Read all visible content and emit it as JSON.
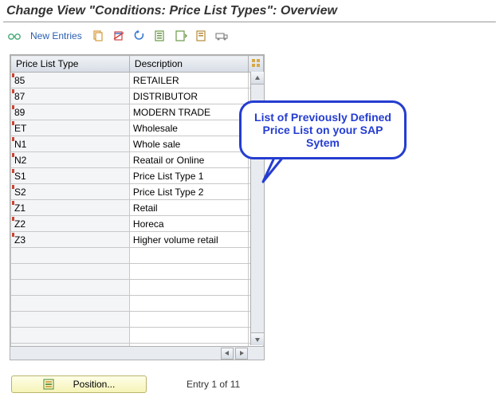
{
  "title": "Change View \"Conditions: Price List Types\": Overview",
  "toolbar": {
    "new_entries": "New Entries"
  },
  "table": {
    "headers": {
      "code": "Price List Type",
      "desc": "Description"
    },
    "rows": [
      {
        "code": "85",
        "desc": "RETAILER"
      },
      {
        "code": "87",
        "desc": "DISTRIBUTOR"
      },
      {
        "code": "89",
        "desc": "MODERN TRADE"
      },
      {
        "code": "ET",
        "desc": "Wholesale"
      },
      {
        "code": "N1",
        "desc": "Whole sale"
      },
      {
        "code": "N2",
        "desc": "Reatail or Online"
      },
      {
        "code": "S1",
        "desc": "Price List Type 1"
      },
      {
        "code": "S2",
        "desc": "Price List Type 2"
      },
      {
        "code": "Z1",
        "desc": "Retail"
      },
      {
        "code": "Z2",
        "desc": "Horeca"
      },
      {
        "code": "Z3",
        "desc": "Higher volume retail"
      },
      {
        "code": "",
        "desc": ""
      },
      {
        "code": "",
        "desc": ""
      },
      {
        "code": "",
        "desc": ""
      },
      {
        "code": "",
        "desc": ""
      },
      {
        "code": "",
        "desc": ""
      },
      {
        "code": "",
        "desc": ""
      },
      {
        "code": "",
        "desc": ""
      }
    ]
  },
  "callout": "List of Previously Defined Price List on your SAP Sytem",
  "footer": {
    "position_label": "Position...",
    "entry_text": "Entry 1 of 11"
  }
}
